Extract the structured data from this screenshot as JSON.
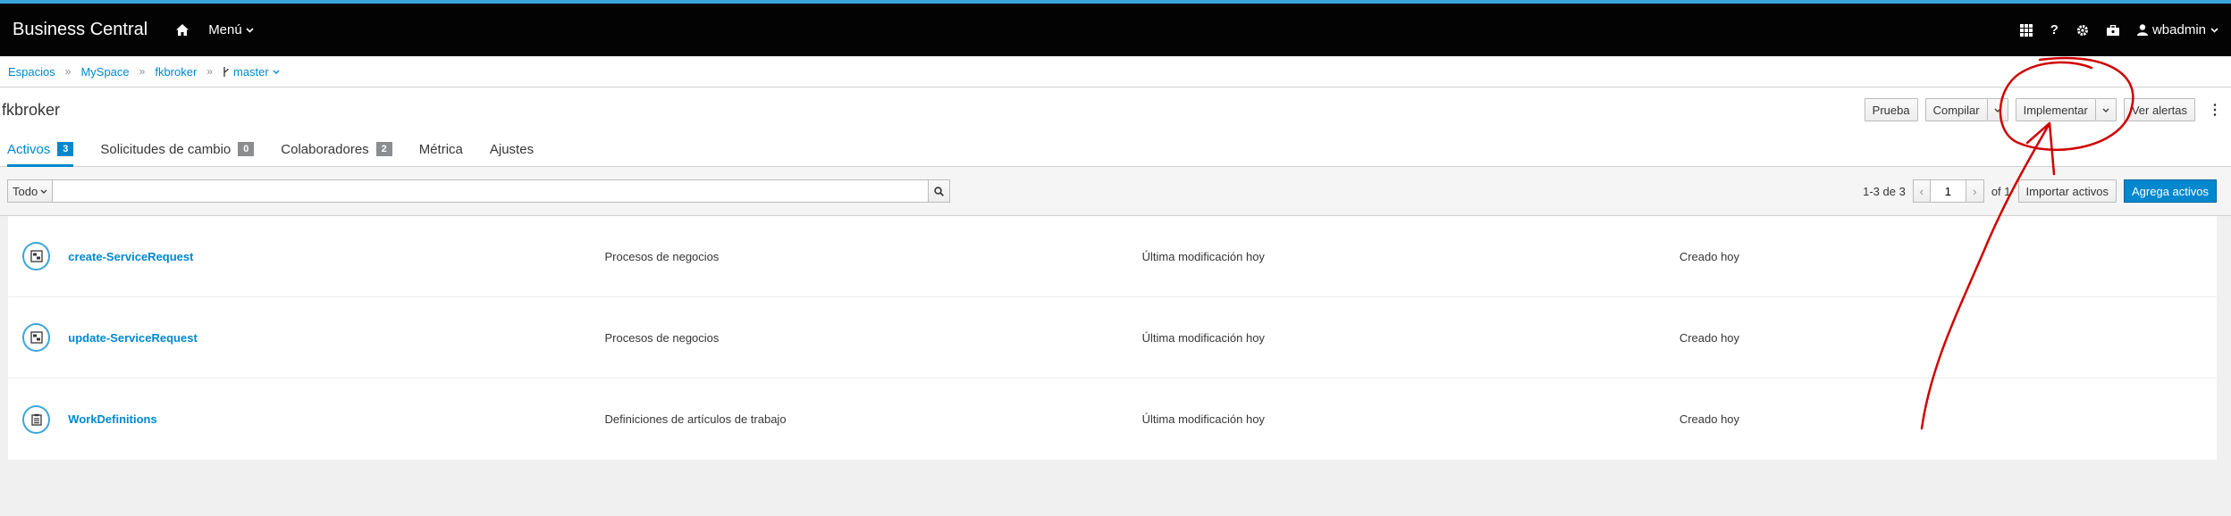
{
  "header": {
    "brand": "Business Central",
    "menu_label": "Menú",
    "user": "wbadmin"
  },
  "breadcrumb": [
    "Espacios",
    "MySpace",
    "fkbroker",
    "master"
  ],
  "project": {
    "title": "fkbroker",
    "buttons": {
      "test": "Prueba",
      "build": "Compilar",
      "deploy": "Implementar",
      "alerts": "Ver alertas"
    }
  },
  "tabs": [
    {
      "label": "Activos",
      "count": "3"
    },
    {
      "label": "Solicitudes de cambio",
      "count": "0"
    },
    {
      "label": "Colaboradores",
      "count": "2"
    },
    {
      "label": "Métrica"
    },
    {
      "label": "Ajustes"
    }
  ],
  "toolbar": {
    "filter_label": "Todo",
    "search_value": "",
    "range": "1-3 de 3",
    "page": "1",
    "of_pages": "of 1",
    "import": "Importar activos",
    "add": "Agrega activos"
  },
  "assets": [
    {
      "name": "create-ServiceRequest",
      "type": "Procesos de negocios",
      "modified": "Última modificación hoy",
      "created": "Creado hoy",
      "icon": "process-icon"
    },
    {
      "name": "update-ServiceRequest",
      "type": "Procesos de negocios",
      "modified": "Última modificación hoy",
      "created": "Creado hoy",
      "icon": "process-icon"
    },
    {
      "name": "WorkDefinitions",
      "type": "Definiciones de artículos de trabajo",
      "modified": "Última modificación hoy",
      "created": "Creado hoy",
      "icon": "work-definitions-icon"
    }
  ],
  "colors": {
    "accent": "#0088ce",
    "masthead": "#030303",
    "annotation": "#d00000"
  }
}
